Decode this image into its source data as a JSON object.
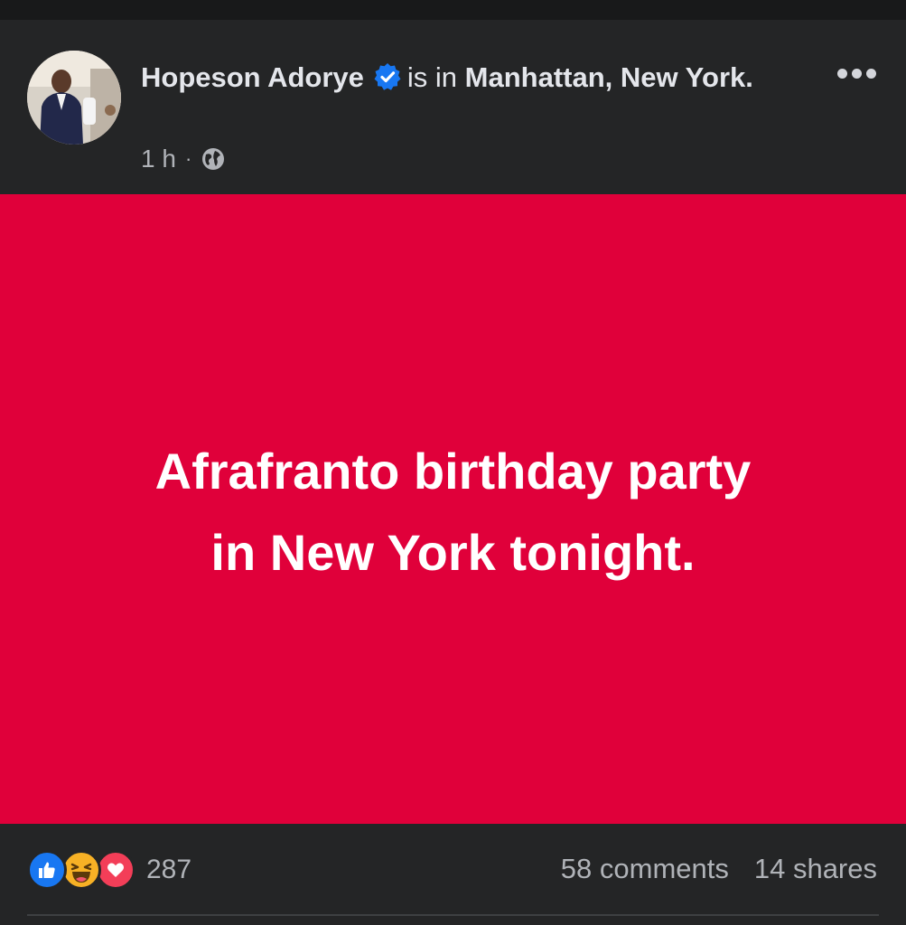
{
  "post": {
    "author": "Hopeson Adorye",
    "is_in": "is in",
    "location": "Manhattan, New York.",
    "time": "1 h",
    "separator": "·",
    "privacy_icon": "globe-icon",
    "verified_icon": "verified-badge-icon",
    "more_icon": "more-options-icon",
    "background_color": "#e0003a",
    "text": "Afrafranto birthday party in New York tonight."
  },
  "engagement": {
    "reaction_icons": [
      "like-icon",
      "haha-icon",
      "love-icon"
    ],
    "reaction_count": "287",
    "comments": "58 comments",
    "shares": "14 shares"
  }
}
